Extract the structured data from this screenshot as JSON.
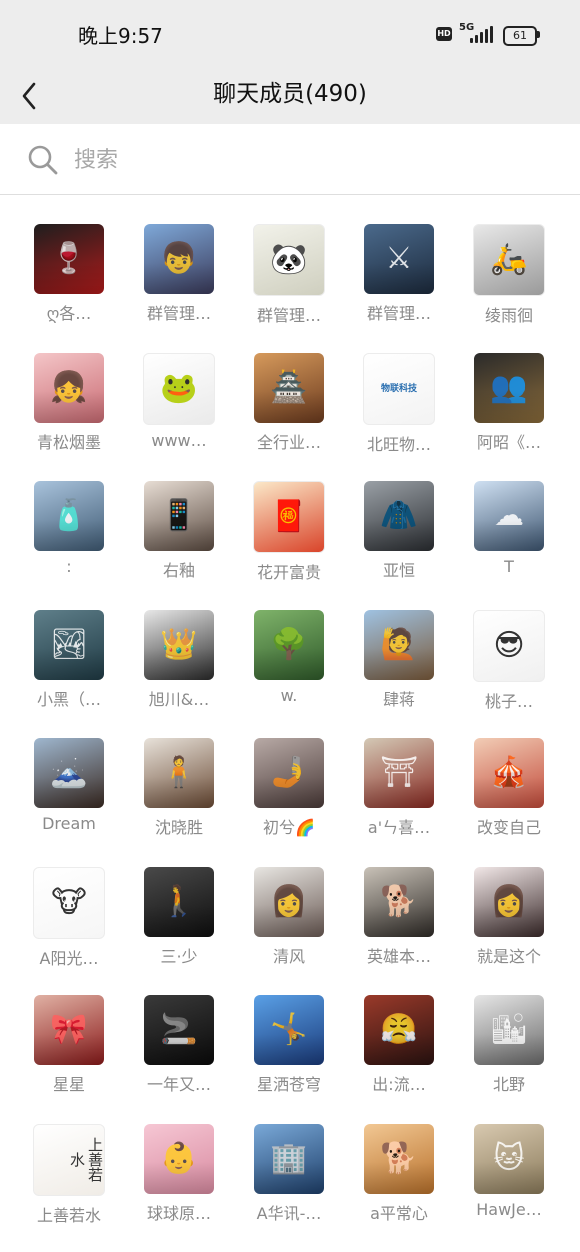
{
  "status_bar": {
    "time": "晚上9:57",
    "hd": "HD",
    "network": "5G",
    "battery": "61"
  },
  "nav": {
    "back_icon": "chevron-left-icon",
    "title": "聊天成员(490)"
  },
  "search": {
    "icon": "search-icon",
    "placeholder": "搜索"
  },
  "members": [
    {
      "name": "ღ各…",
      "bg": "#1e1e1e, #b01a1a",
      "glyph": "🍷"
    },
    {
      "name": "群管理…",
      "bg": "#7fa9d9, #3a3a5a",
      "glyph": "👦"
    },
    {
      "name": "群管理…",
      "bg": "#f2f2ea, #cfcfbf",
      "glyph": "🐼",
      "light": true
    },
    {
      "name": "群管理…",
      "bg": "#4b6a8c, #1c2a3c",
      "glyph": "⚔"
    },
    {
      "name": "绫雨徊",
      "bg": "#e8e8e8, #9a9a9a",
      "glyph": "🛵",
      "light": true
    },
    {
      "name": "青松烟墨",
      "bg": "#f4c6c8, #c96a72",
      "glyph": "👧"
    },
    {
      "name": "www…",
      "bg": "#ffffff, #eaeaea",
      "glyph": "🐸",
      "light": true
    },
    {
      "name": "全行业…",
      "bg": "#d69a5c, #6b3a1e",
      "glyph": "🏯"
    },
    {
      "name": "北旺物…",
      "bg": "#ffffff, #f3f3f3",
      "glyph": "",
      "light": true,
      "logo": "物联科技"
    },
    {
      "name": "阿昭《…",
      "bg": "#2a2a2a, #8a6b3a",
      "glyph": "👥"
    },
    {
      "name": ":",
      "bg": "#a9c3dc, #3f5a73",
      "glyph": "🧴"
    },
    {
      "name": "右釉",
      "bg": "#e7ddd4, #5a4a40",
      "glyph": "📱"
    },
    {
      "name": "花开富贵",
      "bg": "#fbe8c8, #d9442a",
      "glyph": "🧧",
      "light": true
    },
    {
      "name": "亚恒",
      "bg": "#9aa0a6, #2a2d31",
      "glyph": "🧥"
    },
    {
      "name": "T",
      "bg": "#cfe0f2, #3d5570",
      "glyph": "☁"
    },
    {
      "name": "小黑（…",
      "bg": "#5f7f8a, #1f3a44",
      "glyph": "🏞"
    },
    {
      "name": "旭川&…",
      "bg": "#e8e8e8, #2a2a2a",
      "glyph": "👑"
    },
    {
      "name": "w.",
      "bg": "#7fb36a, #2f5a2a",
      "glyph": "🌳"
    },
    {
      "name": "肆蒋",
      "bg": "#9fc2e2, #7a5a3a",
      "glyph": "🙋"
    },
    {
      "name": "桃子…",
      "bg": "#ffffff, #f0f0f0",
      "glyph": "😎",
      "light": true
    },
    {
      "name": "Dream",
      "bg": "#9fb7cf, #3a2a22",
      "glyph": "🗻"
    },
    {
      "name": "沈晓胜",
      "bg": "#e8e2da, #6a4a34",
      "glyph": "🧍"
    },
    {
      "name": "初兮🌈",
      "bg": "#b8aaa6, #4a3a38",
      "glyph": "🤳"
    },
    {
      "name": "a'ㄣ喜…",
      "bg": "#d4c9b6, #8a2a22",
      "glyph": "⛩"
    },
    {
      "name": "改变自己",
      "bg": "#f2cdb6, #c24a3a",
      "glyph": "🎪"
    },
    {
      "name": "A阳光…",
      "bg": "#ffffff, #f6f6f6",
      "glyph": "🐮",
      "light": true
    },
    {
      "name": "三·少",
      "bg": "#4a4a4a, #0e0e0e",
      "glyph": "🚶"
    },
    {
      "name": "清风",
      "bg": "#e8e6e2, #6a5a54",
      "glyph": "👩"
    },
    {
      "name": "英雄本…",
      "bg": "#c9c2b8, #2e2a26",
      "glyph": "🐕"
    },
    {
      "name": "就是这个",
      "bg": "#f2e8e8, #3a2a2a",
      "glyph": "👩"
    },
    {
      "name": "星星",
      "bg": "#e0b1a4, #8a1a1a",
      "glyph": "🎀"
    },
    {
      "name": "一年又…",
      "bg": "#3a3a3a, #0a0a0a",
      "glyph": "🚬"
    },
    {
      "name": "星洒苍穹",
      "bg": "#5aa0e6, #1a3a7a",
      "glyph": "🤸"
    },
    {
      "name": "出:流…",
      "bg": "#9a3a2a, #2a1210",
      "glyph": "😤"
    },
    {
      "name": "北野",
      "bg": "#e6e6e6, #6a6a6a",
      "glyph": "🏙"
    },
    {
      "name": "上善若水",
      "bg": "#ffffff, #f0ece6",
      "glyph": "上善若水",
      "light": true,
      "text_avatar": true
    },
    {
      "name": "球球原…",
      "bg": "#f6c7d4, #d88aa0",
      "glyph": "👶"
    },
    {
      "name": "A华讯-…",
      "bg": "#7aa9d8, #1e3f6a",
      "glyph": "🏢"
    },
    {
      "name": "a平常心",
      "bg": "#f2c894, #b8702a",
      "glyph": "🐕"
    },
    {
      "name": "HawJe…",
      "bg": "#d8c9b0, #8a7a5a",
      "glyph": "🐱"
    }
  ]
}
